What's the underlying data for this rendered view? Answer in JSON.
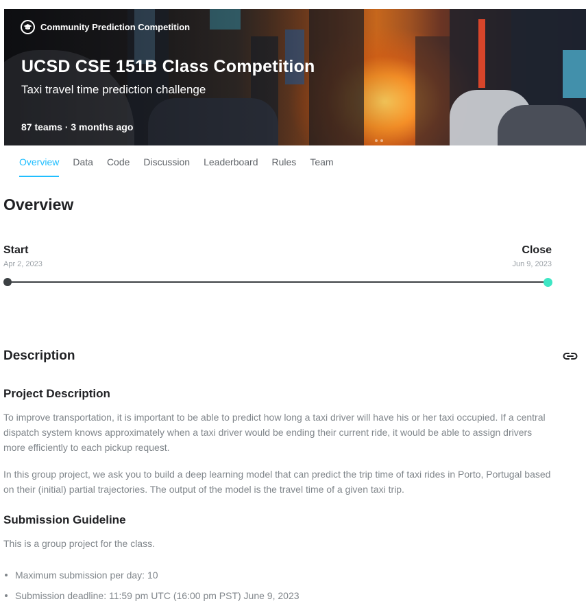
{
  "hero": {
    "kicker": "Community Prediction Competition",
    "title": "UCSD CSE 151B Class Competition",
    "subtitle": "Taxi travel time prediction challenge",
    "meta": "87 teams · 3 months ago",
    "badge_icon": "graduation-cap-icon",
    "accent": "#d8701f"
  },
  "tabs": [
    {
      "label": "Overview",
      "active": true
    },
    {
      "label": "Data"
    },
    {
      "label": "Code"
    },
    {
      "label": "Discussion"
    },
    {
      "label": "Leaderboard"
    },
    {
      "label": "Rules"
    },
    {
      "label": "Team"
    }
  ],
  "overview": {
    "heading": "Overview",
    "start_label": "Start",
    "start_date": "Apr 2, 2023",
    "close_label": "Close",
    "close_date": "Jun 9, 2023",
    "end_dot_color": "#3ee6c4"
  },
  "description": {
    "heading": "Description",
    "link_icon": "link-icon",
    "project_heading": "Project Description",
    "p1": "To improve transportation, it is important to be able to predict how long a taxi driver will have his or her taxi occupied. If a central dispatch system knows approximately when a taxi driver would be ending their current ride, it would be able to assign drivers more efficiently to each pickup request.",
    "p2": "In this group project, we ask you to build a deep learning model that can predict the trip time of taxi rides in Porto, Portugal based on their (initial) partial trajectories. The output of the model is the travel time of a given taxi trip.",
    "submission_heading": "Submission Guideline",
    "p3": "This is a group project for the class.",
    "bullets": [
      "Maximum submission per day: 10",
      "Submission deadline: 11:59 pm UTC (16:00 pm PST) June 9, 2023"
    ]
  },
  "accent_color": "#20beff"
}
